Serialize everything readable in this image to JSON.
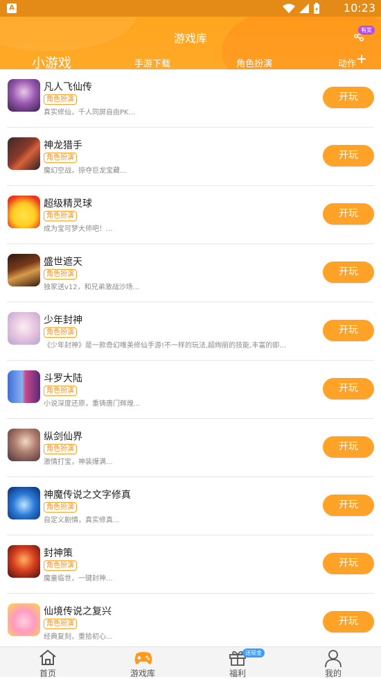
{
  "status_bar": {
    "time": "10:23",
    "app_badge": "A"
  },
  "header": {
    "title": "游戏库",
    "share_badge": "有奖",
    "tabs": [
      {
        "label": "小游戏",
        "active": true
      },
      {
        "label": "手游下载",
        "active": false
      },
      {
        "label": "角色扮演",
        "active": false
      },
      {
        "label": "动作",
        "active": false
      }
    ]
  },
  "games": [
    {
      "name": "凡人飞仙传",
      "tag": "角色扮演",
      "desc": "真实修仙，千人同屏自由PK...",
      "button": "开玩"
    },
    {
      "name": "神龙猎手",
      "tag": "角色扮演",
      "desc": "魔幻空战，掠夺巨龙宝藏...",
      "button": "开玩"
    },
    {
      "name": "超级精灵球",
      "tag": "角色扮演",
      "desc": "成为宝可梦大师吧！...",
      "button": "开玩"
    },
    {
      "name": "盛世遮天",
      "tag": "角色扮演",
      "desc": "独家送v12，和兄弟激战沙场...",
      "button": "开玩"
    },
    {
      "name": "少年封神",
      "tag": "角色扮演",
      "desc": "《少年封神》是一款奇幻唯美修仙手游!不一样的玩法,超绚丽的技能,丰富的即...",
      "button": "开玩"
    },
    {
      "name": "斗罗大陆",
      "tag": "角色扮演",
      "desc": "小说深度还原，重铸唐门辉煌...",
      "button": "开玩"
    },
    {
      "name": "纵剑仙界",
      "tag": "角色扮演",
      "desc": "激情打宝，神装爆满...",
      "button": "开玩"
    },
    {
      "name": "神魔传说之文字修真",
      "tag": "角色扮演",
      "desc": "自定义剧情，真实修真...",
      "button": "开玩"
    },
    {
      "name": "封神策",
      "tag": "角色扮演",
      "desc": "魔童临世，一键封神...",
      "button": "开玩"
    },
    {
      "name": "仙境传说之复兴",
      "tag": "角色扮演",
      "desc": "经典复刻，重拾初心...",
      "button": "开玩"
    }
  ],
  "bottom_nav": [
    {
      "label": "首页",
      "icon": "home-icon",
      "active": false
    },
    {
      "label": "游戏库",
      "icon": "gamepad-icon",
      "active": true
    },
    {
      "label": "福利",
      "icon": "gift-icon",
      "active": false,
      "badge": "送现金"
    },
    {
      "label": "我的",
      "icon": "user-icon",
      "active": false
    }
  ],
  "colors": {
    "accent": "#ffa228",
    "header": "#ffa51f",
    "tag": "#ff8f14"
  }
}
